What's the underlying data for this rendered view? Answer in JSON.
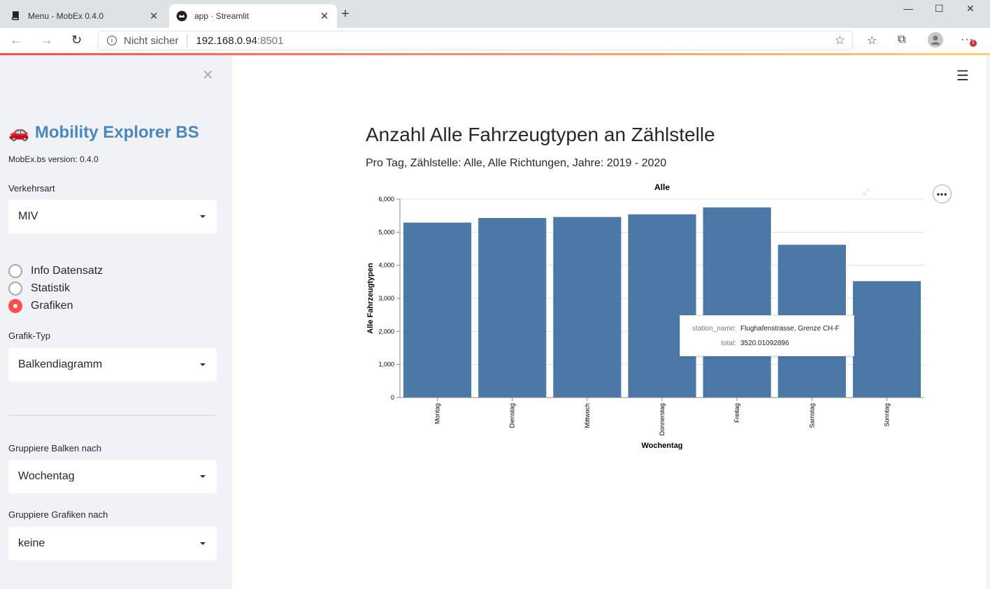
{
  "browser": {
    "tabs": [
      {
        "title": "Menu - MobEx 0.4.0",
        "icon": "book-icon",
        "active": false
      },
      {
        "title": "app · Streamlit",
        "icon": "streamlit-crown-icon",
        "active": true
      }
    ],
    "address": {
      "security_label": "Nicht sicher",
      "host": "192.168.0.94",
      "port": ":8501"
    },
    "notification_badge": "1"
  },
  "sidebar": {
    "title": "Mobility Explorer BS",
    "title_icon": "🚗",
    "version": "MobEx.bs version: 0.4.0",
    "verkehrsart": {
      "label": "Verkehrsart",
      "value": "MIV"
    },
    "radios": [
      {
        "label": "Info Datensatz",
        "checked": false
      },
      {
        "label": "Statistik",
        "checked": false
      },
      {
        "label": "Grafiken",
        "checked": true
      }
    ],
    "grafik_typ": {
      "label": "Grafik-Typ",
      "value": "Balkendiagramm"
    },
    "gruppiere_balken": {
      "label": "Gruppiere Balken nach",
      "value": "Wochentag"
    },
    "gruppiere_grafiken": {
      "label": "Gruppiere Grafiken nach",
      "value": "keine"
    }
  },
  "main": {
    "title": "Anzahl Alle Fahrzeugtypen an Zählstelle",
    "subtitle": "Pro Tag, Zählstelle: Alle, Alle Richtungen, Jahre: 2019 - 2020",
    "tooltip": {
      "rows": [
        {
          "key": "station_name:",
          "value": "Flughafenstrasse, Grenze CH-F"
        },
        {
          "key": "total:",
          "value": "3520.01092896"
        }
      ]
    }
  },
  "chart_data": {
    "type": "bar",
    "title": "Alle",
    "xlabel": "Wochentag",
    "ylabel": "Alle Fahrzeugtypen",
    "categories": [
      "Montag",
      "Dienstag",
      "Mittwoch",
      "Donnerstag",
      "Freitag",
      "Samstag",
      "Sonntag"
    ],
    "values": [
      5290,
      5430,
      5460,
      5540,
      5750,
      4620,
      3520
    ],
    "ylim": [
      0,
      6000
    ],
    "yticks": [
      "0",
      "1,000",
      "2,000",
      "3,000",
      "4,000",
      "5,000",
      "6,000"
    ],
    "bar_color": "#4c78a8",
    "grid": true
  }
}
